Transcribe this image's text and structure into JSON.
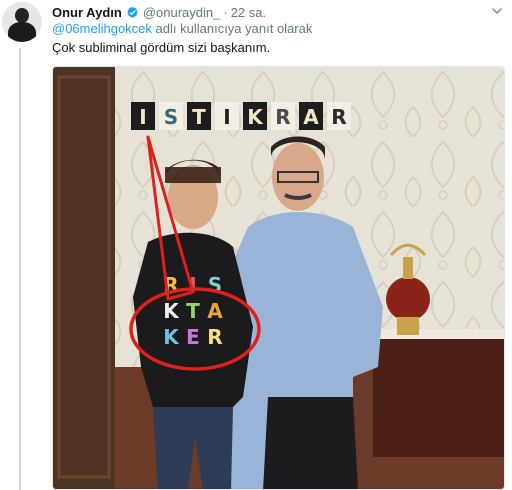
{
  "tweet": {
    "author_name": "Onur Aydın",
    "handle": "@onuraydin_",
    "separator": "·",
    "time": "22 sa.",
    "reply_mention": "@06melihgokcek",
    "reply_suffix": "adlı kullanıcıya yanıt olarak",
    "text": "Çok subliminal gördüm sizi başkanım."
  },
  "photo": {
    "wall_letters": [
      "I",
      "S",
      "T",
      "I",
      "K",
      "R",
      "A",
      "R"
    ],
    "shirt_rows": [
      [
        "R",
        "I",
        "S"
      ],
      [
        "K",
        "T",
        "A"
      ],
      [
        "K",
        "E",
        "R"
      ]
    ]
  },
  "colors": {
    "link": "#1da1f2",
    "secondary_text": "#657786",
    "verified_badge": "#1da1f2",
    "annotation": "#e0201a"
  },
  "icons": {
    "verified": "verified-badge-icon",
    "more": "chevron-down-icon"
  }
}
